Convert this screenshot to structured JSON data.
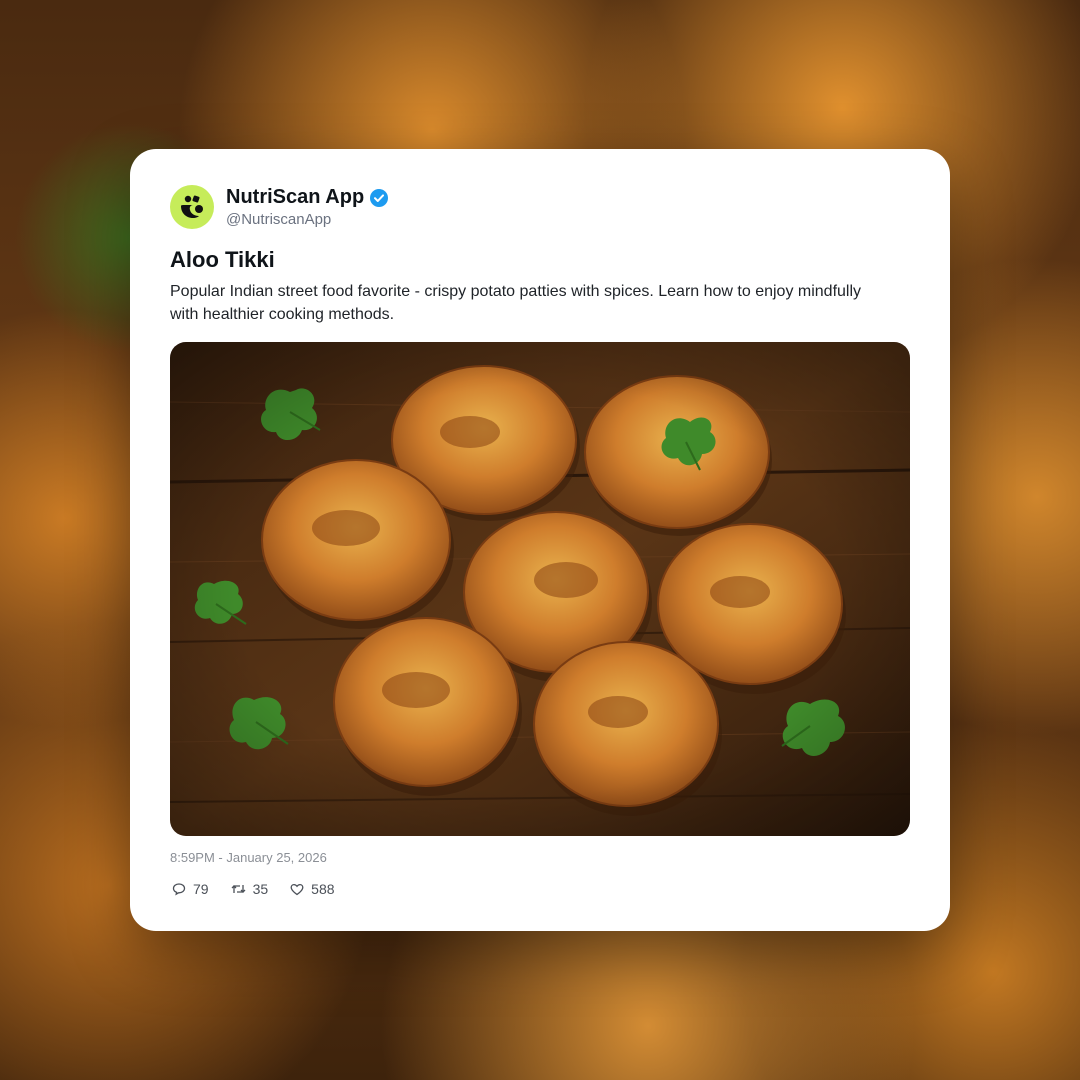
{
  "post": {
    "author": {
      "display_name": "NutriScan App",
      "handle": "@NutriscanApp",
      "verified": true,
      "avatar_icon": "nutriscan-logo-icon",
      "avatar_color": "#c6ec5a"
    },
    "title": "Aloo Tikki",
    "body": "Popular Indian street food favorite - crispy potato patties with spices. Learn how to enjoy mindfully with healthier cooking methods.",
    "image": {
      "subject_icon": "aloo-tikki-photo"
    },
    "timestamp": "8:59PM - January 25, 2026",
    "stats": {
      "replies": "79",
      "reposts": "35",
      "likes": "588"
    }
  },
  "colors": {
    "verified_badge": "#1d9bf0",
    "patty": "#c8742a",
    "wood": "#4a2a12",
    "cilantro": "#3f8a2a"
  }
}
